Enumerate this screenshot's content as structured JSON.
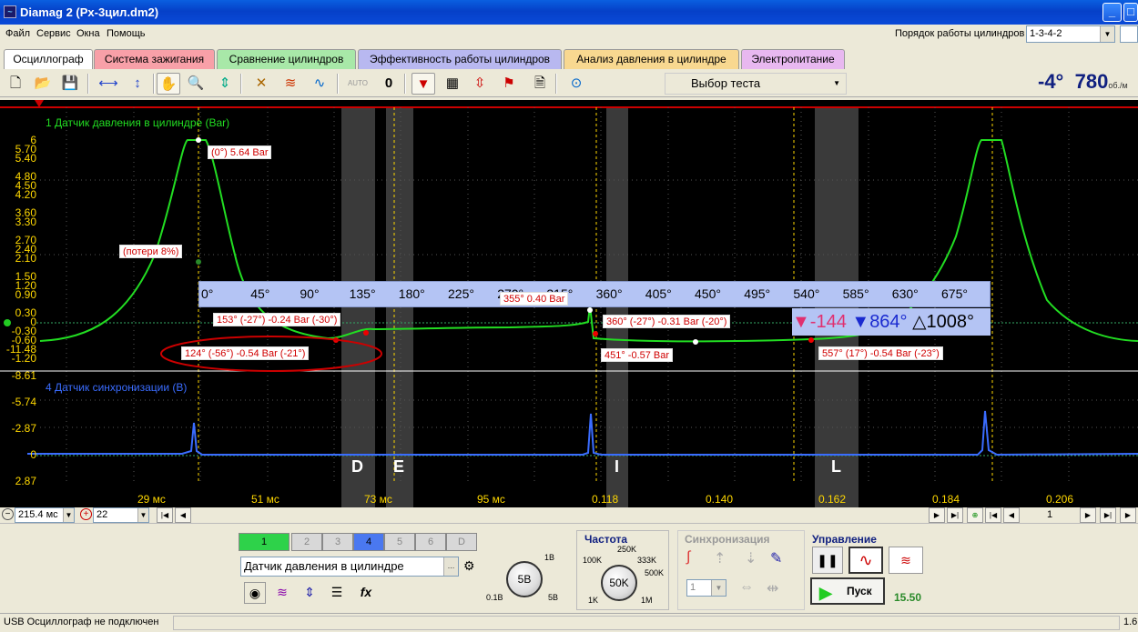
{
  "window": {
    "title": "Diamag 2 (Px-3цил.dm2)"
  },
  "menu": [
    "Файл",
    "Сервис",
    "Окна",
    "Помощь"
  ],
  "cyl_order": {
    "label": "Порядок работы цилиндров",
    "value": "1-3-4-2"
  },
  "tabs": [
    {
      "label": "Осциллограф",
      "color": "#ece9d8"
    },
    {
      "label": "Система зажигания",
      "color": "#f8a0a8"
    },
    {
      "label": "Сравнение цилиндров",
      "color": "#a8e8a8"
    },
    {
      "label": "Эффективность работы цилиндров",
      "color": "#b8b8f0"
    },
    {
      "label": "Анализ давления в цилиндре",
      "color": "#f8d890"
    },
    {
      "label": "Электропитание",
      "color": "#e8b8f0"
    }
  ],
  "toolbar": {
    "auto_label": "AUTO",
    "counter": "0",
    "test_select": "Выбор теста"
  },
  "rpm": {
    "angle": "-4°",
    "value": "780",
    "unit": "об./м"
  },
  "scope": {
    "ch1_title": "1 Датчик давления в цилиндре (Bar)",
    "ch4_title": "4 Датчик синхронизации (В)",
    "ch1_ticks": [
      "6",
      "5.70",
      "5.40",
      "4.80",
      "4.50",
      "4.20",
      "3.60",
      "3.30",
      "2.70",
      "2.40",
      "2.10",
      "1.50",
      "1.20",
      "0.90",
      "0.30",
      "0",
      "-0.30",
      "-0.60",
      "-1.20"
    ],
    "ch4_ticks": [
      "-11.48",
      "-8.61",
      "-5.74",
      "-2.87",
      "0",
      "2.87"
    ],
    "degrees": [
      "0°",
      "45°",
      "90°",
      "135°",
      "180°",
      "225°",
      "270°",
      "315°",
      "360°",
      "405°",
      "450°",
      "495°",
      "540°",
      "585°",
      "630°",
      "675°"
    ],
    "markers": [
      "D",
      "E",
      "I",
      "L"
    ],
    "time_ticks": [
      "29 мс",
      "51 мс",
      "73 мс",
      "95 мс",
      "0.118",
      "0.140",
      "0.162",
      "0.184",
      "0.206"
    ],
    "labels": {
      "peak": "(0°) 5.64 Bar",
      "loss": "(потери 8%)",
      "l153": "153° (-27°) -0.24 Bar (-30°)",
      "l124": "124° (-56°) -0.54 Bar (-21°)",
      "l355": "355° 0.40 Bar",
      "l360": "360° (-27°) -0.31 Bar (-20°)",
      "l451": "451° -0.57 Bar",
      "l557": "557° (17°) -0.54 Bar (-23°)"
    },
    "cursors": {
      "c1": "-144",
      "c2": "864°",
      "delta": "1008°"
    }
  },
  "nav": {
    "time": "215.4 мс",
    "amp": "22",
    "page": "1"
  },
  "channels": [
    "1",
    "2",
    "3",
    "4",
    "5",
    "6",
    "D"
  ],
  "sensor": {
    "value": "Датчик давления в цилиндре"
  },
  "volt_knob": {
    "center": "5В",
    "k1": "1В",
    "k2": "0.1В",
    "k3": "5В"
  },
  "freq": {
    "title": "Частота",
    "center": "50K",
    "k250": "250K",
    "k100": "100K",
    "k333": "333K",
    "k500": "500K",
    "k1k": "1K",
    "k1m": "1M"
  },
  "sync": {
    "title": "Синхронизация",
    "value": "1"
  },
  "control": {
    "title": "Управление",
    "start": "Пуск",
    "value": "15.50"
  },
  "status": {
    "text": "USB Осциллограф не подключен",
    "right": "1.6"
  }
}
